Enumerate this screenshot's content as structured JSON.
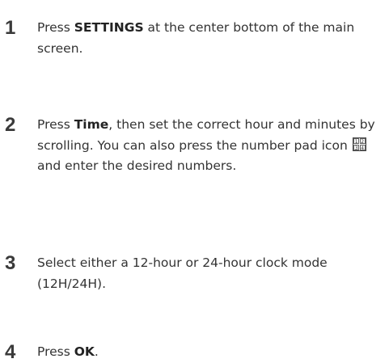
{
  "steps": [
    {
      "number": "1",
      "pre": "Press ",
      "bold": "SETTINGS",
      "post": " at the center bottom of the main screen."
    },
    {
      "number": "2",
      "pre": "Press ",
      "bold": "Time",
      "post": ", then set the correct hour and minutes by scrolling. You can also press the number pad icon ",
      "icon": "number-pad-icon",
      "icon_digits": [
        "1",
        "2",
        "3",
        "4"
      ],
      "post2": " and enter the desired numbers."
    },
    {
      "number": "3",
      "text": "Select either a 12-hour or 24-hour clock mode (12H/24H)."
    },
    {
      "number": "4",
      "pre": "Press ",
      "bold": "OK",
      "post": "."
    }
  ]
}
